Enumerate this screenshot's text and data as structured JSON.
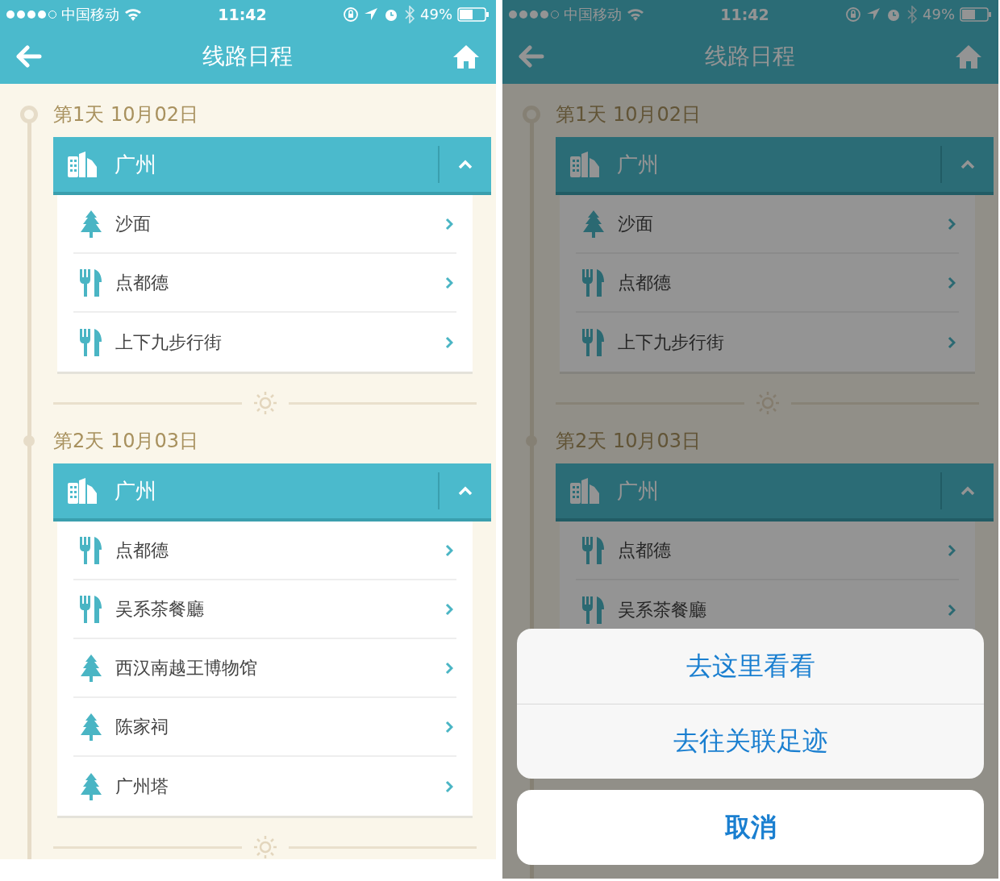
{
  "screens": [
    {
      "status_bar": {
        "carrier": "中国移动",
        "time": "11:42",
        "battery": "49%"
      },
      "nav": {
        "title": "线路日程"
      },
      "dimmed": false,
      "days": [
        {
          "title": "第1天 10月02日",
          "city": {
            "name": "广州",
            "expanded": true
          },
          "items": [
            {
              "kind": "sight",
              "name": "沙面"
            },
            {
              "kind": "food",
              "name": "点都德"
            },
            {
              "kind": "food",
              "name": "上下九步行街"
            }
          ]
        },
        {
          "title": "第2天 10月03日",
          "city": {
            "name": "广州",
            "expanded": true
          },
          "items": [
            {
              "kind": "food",
              "name": "点都德"
            },
            {
              "kind": "food",
              "name": "吴系茶餐廳"
            },
            {
              "kind": "sight",
              "name": "西汉南越王博物馆"
            },
            {
              "kind": "sight",
              "name": "陈家祠"
            },
            {
              "kind": "sight",
              "name": "广州塔"
            }
          ]
        }
      ]
    },
    {
      "status_bar": {
        "carrier": "中国移动",
        "time": "11:42",
        "battery": "49%"
      },
      "nav": {
        "title": "线路日程"
      },
      "dimmed": true,
      "days": [
        {
          "title": "第1天 10月02日",
          "city": {
            "name": "广州",
            "expanded": true
          },
          "items": [
            {
              "kind": "sight",
              "name": "沙面"
            },
            {
              "kind": "food",
              "name": "点都德"
            },
            {
              "kind": "food",
              "name": "上下九步行街"
            }
          ]
        },
        {
          "title": "第2天 10月03日",
          "city": {
            "name": "广州",
            "expanded": true
          },
          "items": [
            {
              "kind": "food",
              "name": "点都德"
            },
            {
              "kind": "food",
              "name": "吴系茶餐廳"
            }
          ]
        }
      ],
      "action_sheet": {
        "actions": [
          "去这里看看",
          "去往关联足迹"
        ],
        "cancel": "取消"
      }
    }
  ]
}
